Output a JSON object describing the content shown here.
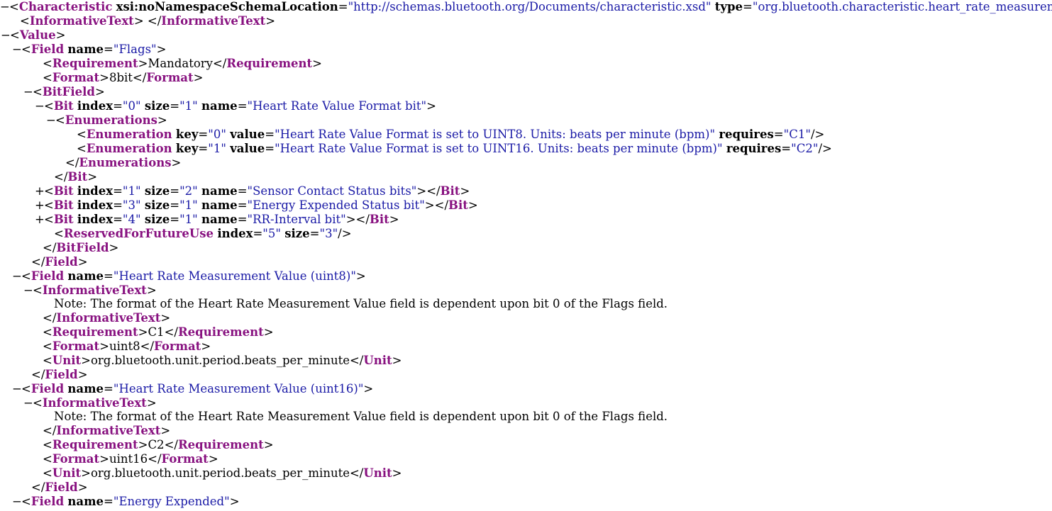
{
  "lines": [
    {
      "indent": 0,
      "toggle": "−",
      "parts": [
        {
          "k": "punct",
          "t": "<"
        },
        {
          "k": "tag",
          "t": "Characteristic"
        },
        {
          "k": "punct",
          "t": " "
        },
        {
          "k": "attr",
          "t": "xsi:noNamespaceSchemaLocation"
        },
        {
          "k": "punct",
          "t": "="
        },
        {
          "k": "val",
          "t": "\"http://schemas.bluetooth.org/Documents/characteristic.xsd\""
        },
        {
          "k": "punct",
          "t": " "
        },
        {
          "k": "attr",
          "t": "type"
        },
        {
          "k": "punct",
          "t": "="
        },
        {
          "k": "val",
          "t": "\"org.bluetooth.characteristic.heart_rate_measurement\""
        },
        {
          "k": "punct",
          "t": ">"
        }
      ]
    },
    {
      "indent": 28,
      "toggle": "",
      "parts": [
        {
          "k": "punct",
          "t": "<"
        },
        {
          "k": "tag",
          "t": "InformativeText"
        },
        {
          "k": "punct",
          "t": "> </"
        },
        {
          "k": "tag",
          "t": "InformativeText"
        },
        {
          "k": "punct",
          "t": ">"
        }
      ]
    },
    {
      "indent": 14,
      "toggle": "−",
      "parts": [
        {
          "k": "punct",
          "t": "<"
        },
        {
          "k": "tag",
          "t": "Value"
        },
        {
          "k": "punct",
          "t": ">"
        }
      ]
    },
    {
      "indent": 30,
      "toggle": "−",
      "parts": [
        {
          "k": "punct",
          "t": "<"
        },
        {
          "k": "tag",
          "t": "Field"
        },
        {
          "k": "punct",
          "t": " "
        },
        {
          "k": "attr",
          "t": "name"
        },
        {
          "k": "punct",
          "t": "="
        },
        {
          "k": "val",
          "t": "\"Flags\""
        },
        {
          "k": "punct",
          "t": ">"
        }
      ]
    },
    {
      "indent": 60,
      "toggle": "",
      "parts": [
        {
          "k": "punct",
          "t": "<"
        },
        {
          "k": "tag",
          "t": "Requirement"
        },
        {
          "k": "punct",
          "t": ">"
        },
        {
          "k": "txt",
          "t": "Mandatory"
        },
        {
          "k": "punct",
          "t": "</"
        },
        {
          "k": "tag",
          "t": "Requirement"
        },
        {
          "k": "punct",
          "t": ">"
        }
      ]
    },
    {
      "indent": 60,
      "toggle": "",
      "parts": [
        {
          "k": "punct",
          "t": "<"
        },
        {
          "k": "tag",
          "t": "Format"
        },
        {
          "k": "punct",
          "t": ">"
        },
        {
          "k": "txt",
          "t": "8bit"
        },
        {
          "k": "punct",
          "t": "</"
        },
        {
          "k": "tag",
          "t": "Format"
        },
        {
          "k": "punct",
          "t": ">"
        }
      ]
    },
    {
      "indent": 46,
      "toggle": "−",
      "parts": [
        {
          "k": "punct",
          "t": "<"
        },
        {
          "k": "tag",
          "t": "BitField"
        },
        {
          "k": "punct",
          "t": ">"
        }
      ]
    },
    {
      "indent": 62,
      "toggle": "−",
      "parts": [
        {
          "k": "punct",
          "t": "<"
        },
        {
          "k": "tag",
          "t": "Bit"
        },
        {
          "k": "punct",
          "t": " "
        },
        {
          "k": "attr",
          "t": "index"
        },
        {
          "k": "punct",
          "t": "="
        },
        {
          "k": "val",
          "t": "\"0\""
        },
        {
          "k": "punct",
          "t": " "
        },
        {
          "k": "attr",
          "t": "size"
        },
        {
          "k": "punct",
          "t": "="
        },
        {
          "k": "val",
          "t": "\"1\""
        },
        {
          "k": "punct",
          "t": " "
        },
        {
          "k": "attr",
          "t": "name"
        },
        {
          "k": "punct",
          "t": "="
        },
        {
          "k": "val",
          "t": "\"Heart Rate Value Format bit\""
        },
        {
          "k": "punct",
          "t": ">"
        }
      ]
    },
    {
      "indent": 78,
      "toggle": "−",
      "parts": [
        {
          "k": "punct",
          "t": "<"
        },
        {
          "k": "tag",
          "t": "Enumerations"
        },
        {
          "k": "punct",
          "t": ">"
        }
      ]
    },
    {
      "indent": 108,
      "toggle": "",
      "parts": [
        {
          "k": "punct",
          "t": "<"
        },
        {
          "k": "tag",
          "t": "Enumeration"
        },
        {
          "k": "punct",
          "t": " "
        },
        {
          "k": "attr",
          "t": "key"
        },
        {
          "k": "punct",
          "t": "="
        },
        {
          "k": "val",
          "t": "\"0\""
        },
        {
          "k": "punct",
          "t": " "
        },
        {
          "k": "attr",
          "t": "value"
        },
        {
          "k": "punct",
          "t": "="
        },
        {
          "k": "val",
          "t": "\"Heart Rate Value Format is set to UINT8. Units: beats per minute (bpm)\""
        },
        {
          "k": "punct",
          "t": " "
        },
        {
          "k": "attr",
          "t": "requires"
        },
        {
          "k": "punct",
          "t": "="
        },
        {
          "k": "val",
          "t": "\"C1\""
        },
        {
          "k": "punct",
          "t": "/>"
        }
      ]
    },
    {
      "indent": 108,
      "toggle": "",
      "parts": [
        {
          "k": "punct",
          "t": "<"
        },
        {
          "k": "tag",
          "t": "Enumeration"
        },
        {
          "k": "punct",
          "t": " "
        },
        {
          "k": "attr",
          "t": "key"
        },
        {
          "k": "punct",
          "t": "="
        },
        {
          "k": "val",
          "t": "\"1\""
        },
        {
          "k": "punct",
          "t": " "
        },
        {
          "k": "attr",
          "t": "value"
        },
        {
          "k": "punct",
          "t": "="
        },
        {
          "k": "val",
          "t": "\"Heart Rate Value Format is set to UINT16. Units: beats per minute (bpm)\""
        },
        {
          "k": "punct",
          "t": " "
        },
        {
          "k": "attr",
          "t": "requires"
        },
        {
          "k": "punct",
          "t": "="
        },
        {
          "k": "val",
          "t": "\"C2\""
        },
        {
          "k": "punct",
          "t": "/>"
        }
      ]
    },
    {
      "indent": 92,
      "toggle": "",
      "parts": [
        {
          "k": "punct",
          "t": "</"
        },
        {
          "k": "tag",
          "t": "Enumerations"
        },
        {
          "k": "punct",
          "t": ">"
        }
      ]
    },
    {
      "indent": 76,
      "toggle": "",
      "parts": [
        {
          "k": "punct",
          "t": "</"
        },
        {
          "k": "tag",
          "t": "Bit"
        },
        {
          "k": "punct",
          "t": ">"
        }
      ]
    },
    {
      "indent": 62,
      "toggle": "+",
      "parts": [
        {
          "k": "punct",
          "t": "<"
        },
        {
          "k": "tag",
          "t": "Bit"
        },
        {
          "k": "punct",
          "t": " "
        },
        {
          "k": "attr",
          "t": "index"
        },
        {
          "k": "punct",
          "t": "="
        },
        {
          "k": "val",
          "t": "\"1\""
        },
        {
          "k": "punct",
          "t": " "
        },
        {
          "k": "attr",
          "t": "size"
        },
        {
          "k": "punct",
          "t": "="
        },
        {
          "k": "val",
          "t": "\"2\""
        },
        {
          "k": "punct",
          "t": " "
        },
        {
          "k": "attr",
          "t": "name"
        },
        {
          "k": "punct",
          "t": "="
        },
        {
          "k": "val",
          "t": "\"Sensor Contact Status bits\""
        },
        {
          "k": "punct",
          "t": "></"
        },
        {
          "k": "tag",
          "t": "Bit"
        },
        {
          "k": "punct",
          "t": ">"
        }
      ]
    },
    {
      "indent": 62,
      "toggle": "+",
      "parts": [
        {
          "k": "punct",
          "t": "<"
        },
        {
          "k": "tag",
          "t": "Bit"
        },
        {
          "k": "punct",
          "t": " "
        },
        {
          "k": "attr",
          "t": "index"
        },
        {
          "k": "punct",
          "t": "="
        },
        {
          "k": "val",
          "t": "\"3\""
        },
        {
          "k": "punct",
          "t": " "
        },
        {
          "k": "attr",
          "t": "size"
        },
        {
          "k": "punct",
          "t": "="
        },
        {
          "k": "val",
          "t": "\"1\""
        },
        {
          "k": "punct",
          "t": " "
        },
        {
          "k": "attr",
          "t": "name"
        },
        {
          "k": "punct",
          "t": "="
        },
        {
          "k": "val",
          "t": "\"Energy Expended Status bit\""
        },
        {
          "k": "punct",
          "t": "></"
        },
        {
          "k": "tag",
          "t": "Bit"
        },
        {
          "k": "punct",
          "t": ">"
        }
      ]
    },
    {
      "indent": 62,
      "toggle": "+",
      "parts": [
        {
          "k": "punct",
          "t": "<"
        },
        {
          "k": "tag",
          "t": "Bit"
        },
        {
          "k": "punct",
          "t": " "
        },
        {
          "k": "attr",
          "t": "index"
        },
        {
          "k": "punct",
          "t": "="
        },
        {
          "k": "val",
          "t": "\"4\""
        },
        {
          "k": "punct",
          "t": " "
        },
        {
          "k": "attr",
          "t": "size"
        },
        {
          "k": "punct",
          "t": "="
        },
        {
          "k": "val",
          "t": "\"1\""
        },
        {
          "k": "punct",
          "t": " "
        },
        {
          "k": "attr",
          "t": "name"
        },
        {
          "k": "punct",
          "t": "="
        },
        {
          "k": "val",
          "t": "\"RR-Interval bit\""
        },
        {
          "k": "punct",
          "t": "></"
        },
        {
          "k": "tag",
          "t": "Bit"
        },
        {
          "k": "punct",
          "t": ">"
        }
      ]
    },
    {
      "indent": 76,
      "toggle": "",
      "parts": [
        {
          "k": "punct",
          "t": "<"
        },
        {
          "k": "tag",
          "t": "ReservedForFutureUse"
        },
        {
          "k": "punct",
          "t": " "
        },
        {
          "k": "attr",
          "t": "index"
        },
        {
          "k": "punct",
          "t": "="
        },
        {
          "k": "val",
          "t": "\"5\""
        },
        {
          "k": "punct",
          "t": " "
        },
        {
          "k": "attr",
          "t": "size"
        },
        {
          "k": "punct",
          "t": "="
        },
        {
          "k": "val",
          "t": "\"3\""
        },
        {
          "k": "punct",
          "t": "/>"
        }
      ]
    },
    {
      "indent": 60,
      "toggle": "",
      "parts": [
        {
          "k": "punct",
          "t": "</"
        },
        {
          "k": "tag",
          "t": "BitField"
        },
        {
          "k": "punct",
          "t": ">"
        }
      ]
    },
    {
      "indent": 44,
      "toggle": "",
      "parts": [
        {
          "k": "punct",
          "t": "</"
        },
        {
          "k": "tag",
          "t": "Field"
        },
        {
          "k": "punct",
          "t": ">"
        }
      ]
    },
    {
      "indent": 30,
      "toggle": "−",
      "parts": [
        {
          "k": "punct",
          "t": "<"
        },
        {
          "k": "tag",
          "t": "Field"
        },
        {
          "k": "punct",
          "t": " "
        },
        {
          "k": "attr",
          "t": "name"
        },
        {
          "k": "punct",
          "t": "="
        },
        {
          "k": "val",
          "t": "\"Heart Rate Measurement Value (uint8)\""
        },
        {
          "k": "punct",
          "t": ">"
        }
      ]
    },
    {
      "indent": 46,
      "toggle": "−",
      "parts": [
        {
          "k": "punct",
          "t": "<"
        },
        {
          "k": "tag",
          "t": "InformativeText"
        },
        {
          "k": "punct",
          "t": ">"
        }
      ]
    },
    {
      "indent": 76,
      "toggle": "",
      "parts": [
        {
          "k": "txt",
          "t": "Note: The format of the Heart Rate Measurement Value field is dependent upon bit 0 of the Flags field."
        }
      ]
    },
    {
      "indent": 60,
      "toggle": "",
      "parts": [
        {
          "k": "punct",
          "t": "</"
        },
        {
          "k": "tag",
          "t": "InformativeText"
        },
        {
          "k": "punct",
          "t": ">"
        }
      ]
    },
    {
      "indent": 60,
      "toggle": "",
      "parts": [
        {
          "k": "punct",
          "t": "<"
        },
        {
          "k": "tag",
          "t": "Requirement"
        },
        {
          "k": "punct",
          "t": ">"
        },
        {
          "k": "txt",
          "t": "C1"
        },
        {
          "k": "punct",
          "t": "</"
        },
        {
          "k": "tag",
          "t": "Requirement"
        },
        {
          "k": "punct",
          "t": ">"
        }
      ]
    },
    {
      "indent": 60,
      "toggle": "",
      "parts": [
        {
          "k": "punct",
          "t": "<"
        },
        {
          "k": "tag",
          "t": "Format"
        },
        {
          "k": "punct",
          "t": ">"
        },
        {
          "k": "txt",
          "t": "uint8"
        },
        {
          "k": "punct",
          "t": "</"
        },
        {
          "k": "tag",
          "t": "Format"
        },
        {
          "k": "punct",
          "t": ">"
        }
      ]
    },
    {
      "indent": 60,
      "toggle": "",
      "parts": [
        {
          "k": "punct",
          "t": "<"
        },
        {
          "k": "tag",
          "t": "Unit"
        },
        {
          "k": "punct",
          "t": ">"
        },
        {
          "k": "txt",
          "t": "org.bluetooth.unit.period.beats_per_minute"
        },
        {
          "k": "punct",
          "t": "</"
        },
        {
          "k": "tag",
          "t": "Unit"
        },
        {
          "k": "punct",
          "t": ">"
        }
      ]
    },
    {
      "indent": 44,
      "toggle": "",
      "parts": [
        {
          "k": "punct",
          "t": "</"
        },
        {
          "k": "tag",
          "t": "Field"
        },
        {
          "k": "punct",
          "t": ">"
        }
      ]
    },
    {
      "indent": 30,
      "toggle": "−",
      "parts": [
        {
          "k": "punct",
          "t": "<"
        },
        {
          "k": "tag",
          "t": "Field"
        },
        {
          "k": "punct",
          "t": " "
        },
        {
          "k": "attr",
          "t": "name"
        },
        {
          "k": "punct",
          "t": "="
        },
        {
          "k": "val",
          "t": "\"Heart Rate Measurement Value (uint16)\""
        },
        {
          "k": "punct",
          "t": ">"
        }
      ]
    },
    {
      "indent": 46,
      "toggle": "−",
      "parts": [
        {
          "k": "punct",
          "t": "<"
        },
        {
          "k": "tag",
          "t": "InformativeText"
        },
        {
          "k": "punct",
          "t": ">"
        }
      ]
    },
    {
      "indent": 76,
      "toggle": "",
      "parts": [
        {
          "k": "txt",
          "t": "Note: The format of the Heart Rate Measurement Value field is dependent upon bit 0 of the Flags field."
        }
      ]
    },
    {
      "indent": 60,
      "toggle": "",
      "parts": [
        {
          "k": "punct",
          "t": "</"
        },
        {
          "k": "tag",
          "t": "InformativeText"
        },
        {
          "k": "punct",
          "t": ">"
        }
      ]
    },
    {
      "indent": 60,
      "toggle": "",
      "parts": [
        {
          "k": "punct",
          "t": "<"
        },
        {
          "k": "tag",
          "t": "Requirement"
        },
        {
          "k": "punct",
          "t": ">"
        },
        {
          "k": "txt",
          "t": "C2"
        },
        {
          "k": "punct",
          "t": "</"
        },
        {
          "k": "tag",
          "t": "Requirement"
        },
        {
          "k": "punct",
          "t": ">"
        }
      ]
    },
    {
      "indent": 60,
      "toggle": "",
      "parts": [
        {
          "k": "punct",
          "t": "<"
        },
        {
          "k": "tag",
          "t": "Format"
        },
        {
          "k": "punct",
          "t": ">"
        },
        {
          "k": "txt",
          "t": "uint16"
        },
        {
          "k": "punct",
          "t": "</"
        },
        {
          "k": "tag",
          "t": "Format"
        },
        {
          "k": "punct",
          "t": ">"
        }
      ]
    },
    {
      "indent": 60,
      "toggle": "",
      "parts": [
        {
          "k": "punct",
          "t": "<"
        },
        {
          "k": "tag",
          "t": "Unit"
        },
        {
          "k": "punct",
          "t": ">"
        },
        {
          "k": "txt",
          "t": "org.bluetooth.unit.period.beats_per_minute"
        },
        {
          "k": "punct",
          "t": "</"
        },
        {
          "k": "tag",
          "t": "Unit"
        },
        {
          "k": "punct",
          "t": ">"
        }
      ]
    },
    {
      "indent": 44,
      "toggle": "",
      "parts": [
        {
          "k": "punct",
          "t": "</"
        },
        {
          "k": "tag",
          "t": "Field"
        },
        {
          "k": "punct",
          "t": ">"
        }
      ]
    },
    {
      "indent": 30,
      "toggle": "−",
      "parts": [
        {
          "k": "punct",
          "t": "<"
        },
        {
          "k": "tag",
          "t": "Field"
        },
        {
          "k": "punct",
          "t": " "
        },
        {
          "k": "attr",
          "t": "name"
        },
        {
          "k": "punct",
          "t": "="
        },
        {
          "k": "val",
          "t": "\"Energy Expended\""
        },
        {
          "k": "punct",
          "t": ">"
        }
      ]
    }
  ],
  "colors": {
    "tag": "#881280",
    "attribute_value": "#1a1aa6",
    "text": "#000000",
    "background": "#ffffff"
  }
}
